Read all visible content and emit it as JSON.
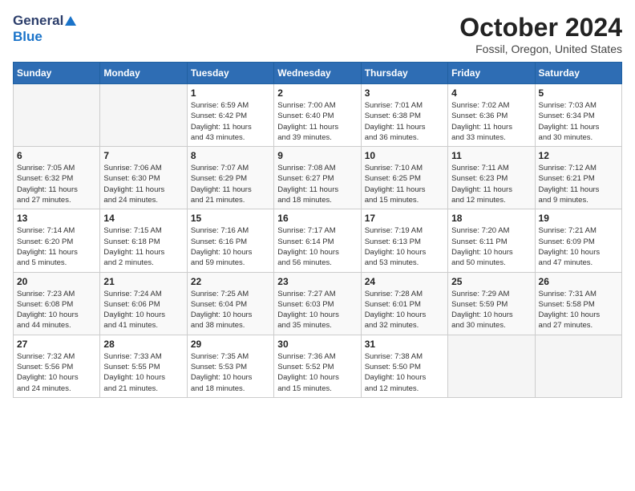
{
  "header": {
    "logo_general": "General",
    "logo_blue": "Blue",
    "month_title": "October 2024",
    "subtitle": "Fossil, Oregon, United States"
  },
  "weekdays": [
    "Sunday",
    "Monday",
    "Tuesday",
    "Wednesday",
    "Thursday",
    "Friday",
    "Saturday"
  ],
  "weeks": [
    [
      {
        "day": "",
        "info": ""
      },
      {
        "day": "",
        "info": ""
      },
      {
        "day": "1",
        "info": "Sunrise: 6:59 AM\nSunset: 6:42 PM\nDaylight: 11 hours\nand 43 minutes."
      },
      {
        "day": "2",
        "info": "Sunrise: 7:00 AM\nSunset: 6:40 PM\nDaylight: 11 hours\nand 39 minutes."
      },
      {
        "day": "3",
        "info": "Sunrise: 7:01 AM\nSunset: 6:38 PM\nDaylight: 11 hours\nand 36 minutes."
      },
      {
        "day": "4",
        "info": "Sunrise: 7:02 AM\nSunset: 6:36 PM\nDaylight: 11 hours\nand 33 minutes."
      },
      {
        "day": "5",
        "info": "Sunrise: 7:03 AM\nSunset: 6:34 PM\nDaylight: 11 hours\nand 30 minutes."
      }
    ],
    [
      {
        "day": "6",
        "info": "Sunrise: 7:05 AM\nSunset: 6:32 PM\nDaylight: 11 hours\nand 27 minutes."
      },
      {
        "day": "7",
        "info": "Sunrise: 7:06 AM\nSunset: 6:30 PM\nDaylight: 11 hours\nand 24 minutes."
      },
      {
        "day": "8",
        "info": "Sunrise: 7:07 AM\nSunset: 6:29 PM\nDaylight: 11 hours\nand 21 minutes."
      },
      {
        "day": "9",
        "info": "Sunrise: 7:08 AM\nSunset: 6:27 PM\nDaylight: 11 hours\nand 18 minutes."
      },
      {
        "day": "10",
        "info": "Sunrise: 7:10 AM\nSunset: 6:25 PM\nDaylight: 11 hours\nand 15 minutes."
      },
      {
        "day": "11",
        "info": "Sunrise: 7:11 AM\nSunset: 6:23 PM\nDaylight: 11 hours\nand 12 minutes."
      },
      {
        "day": "12",
        "info": "Sunrise: 7:12 AM\nSunset: 6:21 PM\nDaylight: 11 hours\nand 9 minutes."
      }
    ],
    [
      {
        "day": "13",
        "info": "Sunrise: 7:14 AM\nSunset: 6:20 PM\nDaylight: 11 hours\nand 5 minutes."
      },
      {
        "day": "14",
        "info": "Sunrise: 7:15 AM\nSunset: 6:18 PM\nDaylight: 11 hours\nand 2 minutes."
      },
      {
        "day": "15",
        "info": "Sunrise: 7:16 AM\nSunset: 6:16 PM\nDaylight: 10 hours\nand 59 minutes."
      },
      {
        "day": "16",
        "info": "Sunrise: 7:17 AM\nSunset: 6:14 PM\nDaylight: 10 hours\nand 56 minutes."
      },
      {
        "day": "17",
        "info": "Sunrise: 7:19 AM\nSunset: 6:13 PM\nDaylight: 10 hours\nand 53 minutes."
      },
      {
        "day": "18",
        "info": "Sunrise: 7:20 AM\nSunset: 6:11 PM\nDaylight: 10 hours\nand 50 minutes."
      },
      {
        "day": "19",
        "info": "Sunrise: 7:21 AM\nSunset: 6:09 PM\nDaylight: 10 hours\nand 47 minutes."
      }
    ],
    [
      {
        "day": "20",
        "info": "Sunrise: 7:23 AM\nSunset: 6:08 PM\nDaylight: 10 hours\nand 44 minutes."
      },
      {
        "day": "21",
        "info": "Sunrise: 7:24 AM\nSunset: 6:06 PM\nDaylight: 10 hours\nand 41 minutes."
      },
      {
        "day": "22",
        "info": "Sunrise: 7:25 AM\nSunset: 6:04 PM\nDaylight: 10 hours\nand 38 minutes."
      },
      {
        "day": "23",
        "info": "Sunrise: 7:27 AM\nSunset: 6:03 PM\nDaylight: 10 hours\nand 35 minutes."
      },
      {
        "day": "24",
        "info": "Sunrise: 7:28 AM\nSunset: 6:01 PM\nDaylight: 10 hours\nand 32 minutes."
      },
      {
        "day": "25",
        "info": "Sunrise: 7:29 AM\nSunset: 5:59 PM\nDaylight: 10 hours\nand 30 minutes."
      },
      {
        "day": "26",
        "info": "Sunrise: 7:31 AM\nSunset: 5:58 PM\nDaylight: 10 hours\nand 27 minutes."
      }
    ],
    [
      {
        "day": "27",
        "info": "Sunrise: 7:32 AM\nSunset: 5:56 PM\nDaylight: 10 hours\nand 24 minutes."
      },
      {
        "day": "28",
        "info": "Sunrise: 7:33 AM\nSunset: 5:55 PM\nDaylight: 10 hours\nand 21 minutes."
      },
      {
        "day": "29",
        "info": "Sunrise: 7:35 AM\nSunset: 5:53 PM\nDaylight: 10 hours\nand 18 minutes."
      },
      {
        "day": "30",
        "info": "Sunrise: 7:36 AM\nSunset: 5:52 PM\nDaylight: 10 hours\nand 15 minutes."
      },
      {
        "day": "31",
        "info": "Sunrise: 7:38 AM\nSunset: 5:50 PM\nDaylight: 10 hours\nand 12 minutes."
      },
      {
        "day": "",
        "info": ""
      },
      {
        "day": "",
        "info": ""
      }
    ]
  ]
}
